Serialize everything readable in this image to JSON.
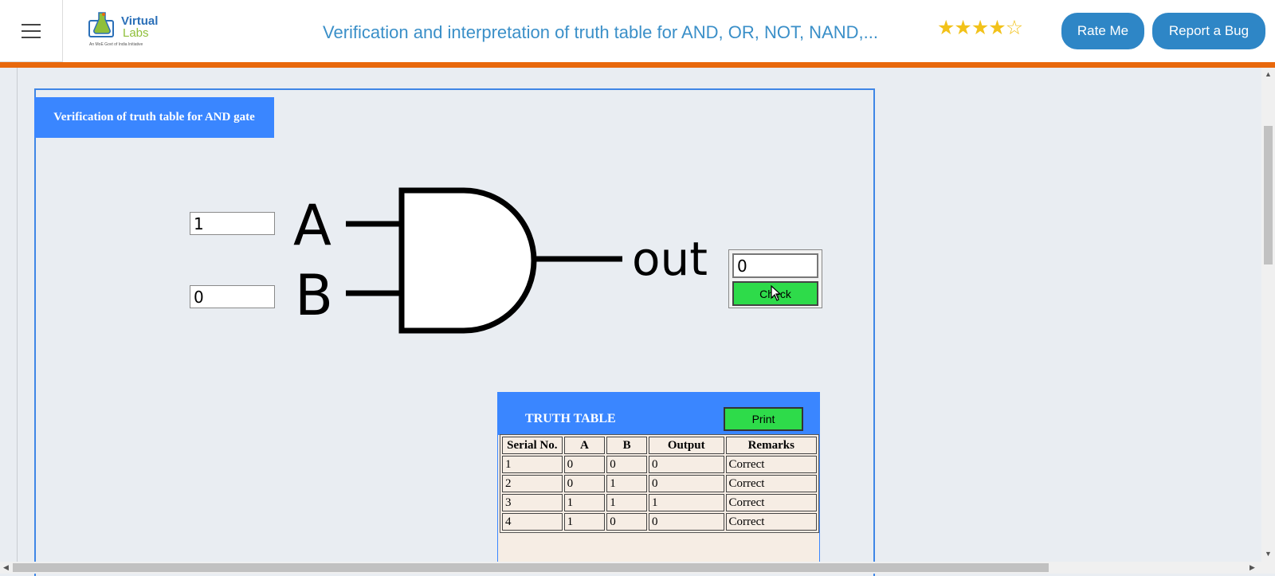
{
  "header": {
    "logo_line1": "Virtual",
    "logo_line2": "Labs",
    "logo_tagline": "An MoE Govt of India Initiative",
    "title": "Verification and interpretation of truth table for AND, OR, NOT, NAND,...",
    "rating": 4,
    "rating_max": 5,
    "rate_button": "Rate Me",
    "bug_button": "Report a Bug"
  },
  "simulator": {
    "section_title": "Verification of truth table for AND gate",
    "input_a_value": "1",
    "input_b_value": "0",
    "label_a": "A",
    "label_b": "B",
    "label_out": "out",
    "output_value": "0",
    "check_button": "Check"
  },
  "truth_table": {
    "title": "TRUTH TABLE",
    "print_button": "Print",
    "columns": [
      "Serial No.",
      "A",
      "B",
      "Output",
      "Remarks"
    ],
    "rows": [
      [
        "1",
        "0",
        "0",
        "0",
        "Correct"
      ],
      [
        "2",
        "0",
        "1",
        "0",
        "Correct"
      ],
      [
        "3",
        "1",
        "1",
        "1",
        "Correct"
      ],
      [
        "4",
        "1",
        "0",
        "0",
        "Correct"
      ]
    ]
  },
  "colors": {
    "accent_blue": "#3a86ff",
    "header_orange": "#e8680c",
    "button_green": "#2edb4a",
    "title_blue": "#3a8fc8"
  }
}
